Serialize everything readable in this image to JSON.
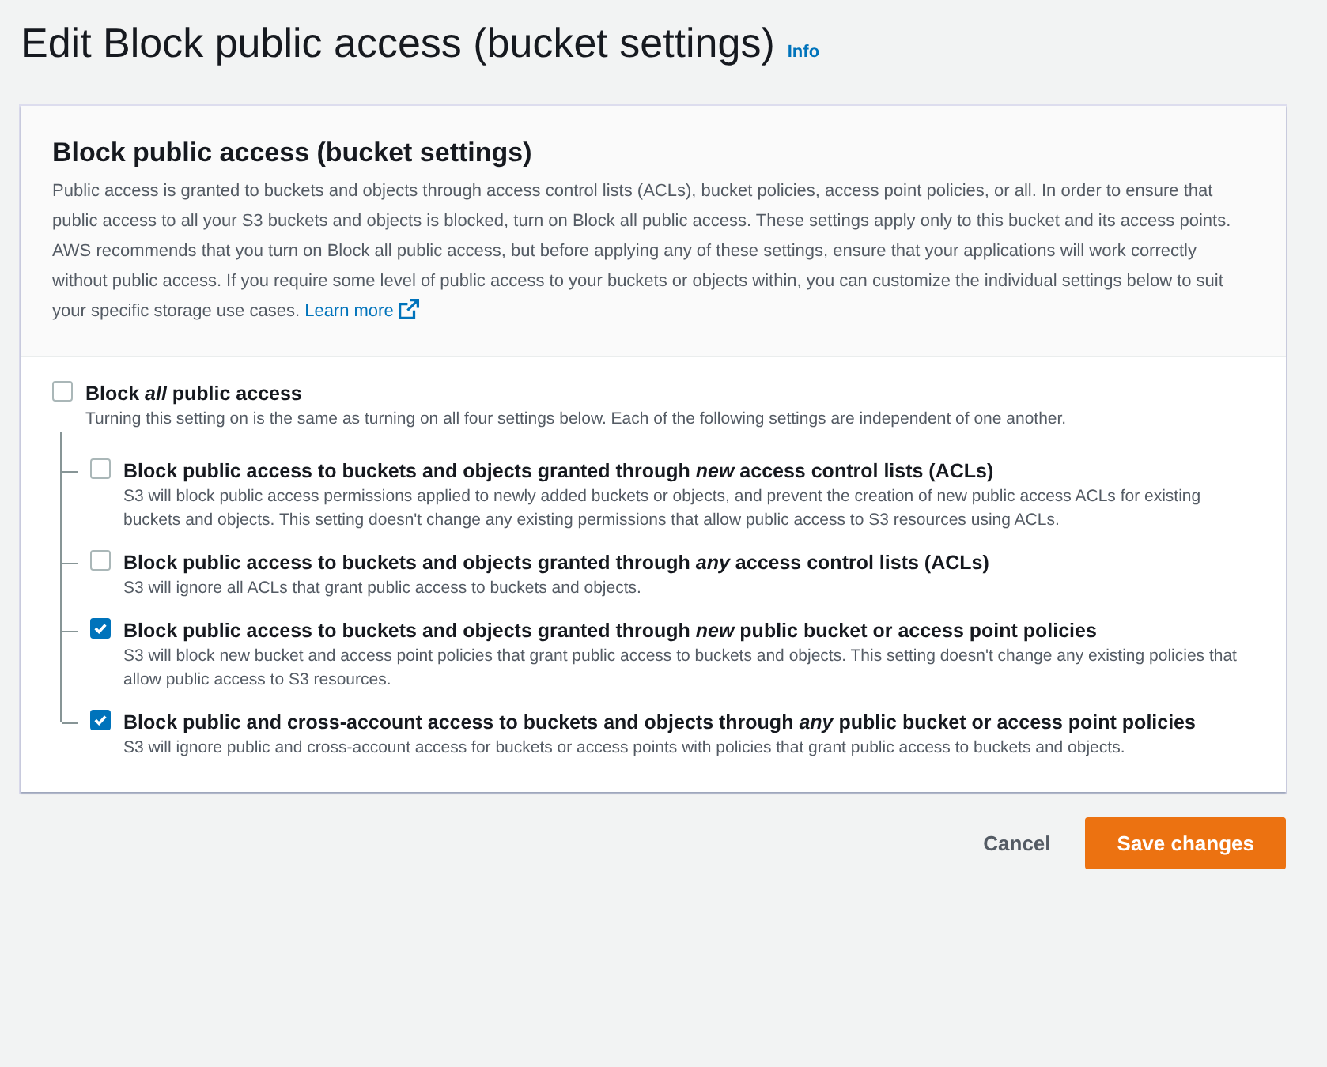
{
  "page": {
    "title": "Edit Block public access (bucket settings)",
    "info_link": "Info"
  },
  "panel": {
    "title": "Block public access (bucket settings)",
    "description": "Public access is granted to buckets and objects through access control lists (ACLs), bucket policies, access point policies, or all. In order to ensure that public access to all your S3 buckets and objects is blocked, turn on Block all public access. These settings apply only to this bucket and its access points. AWS recommends that you turn on Block all public access, but before applying any of these settings, ensure that your applications will work correctly without public access. If you require some level of public access to your buckets or objects within, you can customize the individual settings below to suit your specific storage use cases.",
    "learn_more": "Learn more"
  },
  "setting": {
    "label": "Block *all* public access",
    "description": "Turning this setting on is the same as turning on all four settings below. Each of the following settings are independent of one another.",
    "checked": false,
    "children": [
      {
        "label": "Block public access to buckets and objects granted through *new* access control lists (ACLs)",
        "description": "S3 will block public access permissions applied to newly added buckets or objects, and prevent the creation of new public access ACLs for existing buckets and objects. This setting doesn't change any existing permissions that allow public access to S3 resources using ACLs.",
        "checked": false
      },
      {
        "label": "Block public access to buckets and objects granted through *any* access control lists (ACLs)",
        "description": "S3 will ignore all ACLs that grant public access to buckets and objects.",
        "checked": false
      },
      {
        "label": "Block public access to buckets and objects granted through *new* public bucket or access point policies",
        "description": "S3 will block new bucket and access point policies that grant public access to buckets and objects. This setting doesn't change any existing policies that allow public access to S3 resources.",
        "checked": true
      },
      {
        "label": "Block public and cross-account access to buckets and objects through *any* public bucket or access point policies",
        "description": "S3 will ignore public and cross-account access for buckets or access points with policies that grant public access to buckets and objects.",
        "checked": true
      }
    ]
  },
  "buttons": {
    "cancel": "Cancel",
    "save": "Save changes"
  }
}
